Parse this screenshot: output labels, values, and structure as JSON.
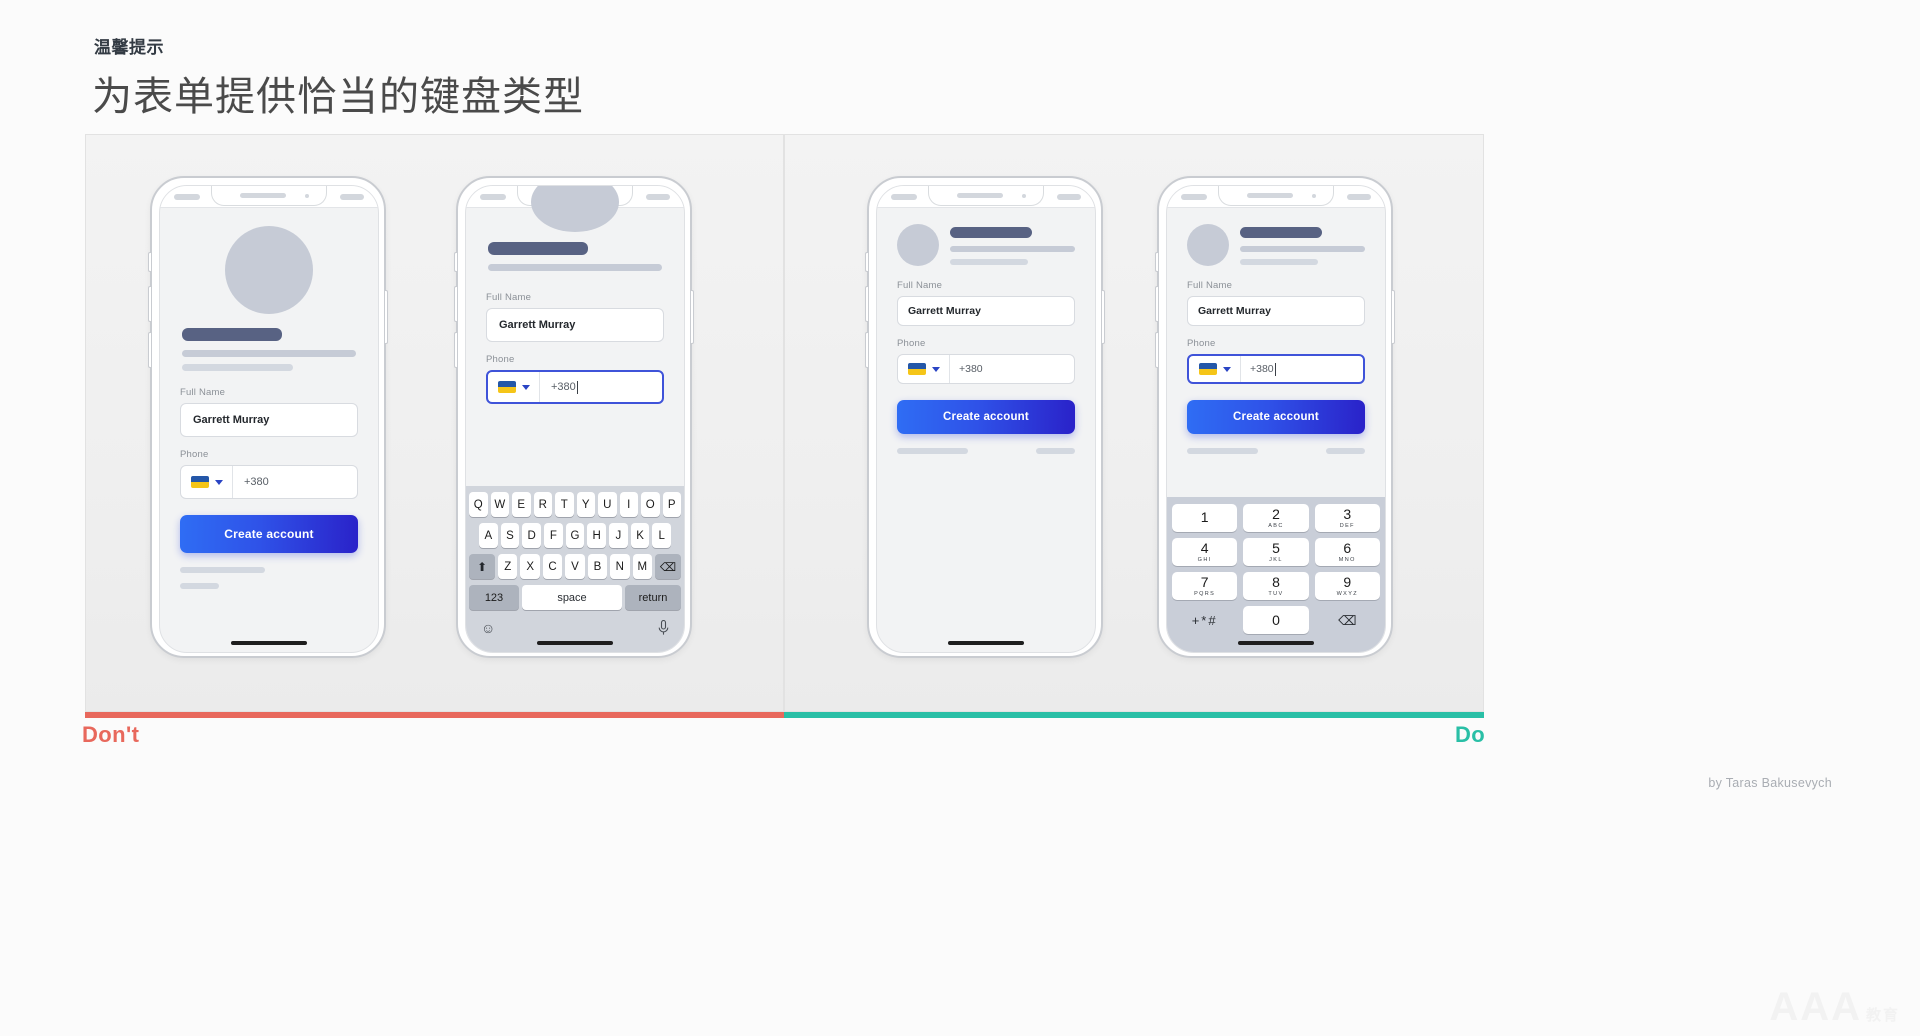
{
  "header": {
    "kicker": "温馨提示",
    "headline": "为表单提供恰当的键盘类型"
  },
  "verdicts": {
    "dont": "Don't",
    "do": "Do",
    "dont_color": "#e8685c",
    "do_color": "#29bfa6"
  },
  "credit": "by Taras Bakusevych",
  "watermark": {
    "text": "AAA",
    "sub": "教育"
  },
  "form": {
    "full_name_label": "Full Name",
    "full_name_value": "Garrett Murray",
    "phone_label": "Phone",
    "phone_placeholder": "+380",
    "cta_label": "Create account",
    "country_flag": "ukraine-flag"
  },
  "keyboard_qwerty": {
    "row1": [
      "Q",
      "W",
      "E",
      "R",
      "T",
      "Y",
      "U",
      "I",
      "O",
      "P"
    ],
    "row2": [
      "A",
      "S",
      "D",
      "F",
      "G",
      "H",
      "J",
      "K",
      "L"
    ],
    "row3": [
      "Z",
      "X",
      "C",
      "V",
      "B",
      "N",
      "M"
    ],
    "shift": "⬆",
    "backspace": "⌫",
    "numbers_key": "123",
    "space_key": "space",
    "return_key": "return",
    "emoji": "☺",
    "mic": "🎤"
  },
  "keypad_numeric": {
    "keys": [
      {
        "digit": "1",
        "letters": ""
      },
      {
        "digit": "2",
        "letters": "ABC"
      },
      {
        "digit": "3",
        "letters": "DEF"
      },
      {
        "digit": "4",
        "letters": "GHI"
      },
      {
        "digit": "5",
        "letters": "JKL"
      },
      {
        "digit": "6",
        "letters": "MNO"
      },
      {
        "digit": "7",
        "letters": "PQRS"
      },
      {
        "digit": "8",
        "letters": "TUV"
      },
      {
        "digit": "9",
        "letters": "WXYZ"
      },
      {
        "digit": "+*#",
        "letters": ""
      },
      {
        "digit": "0",
        "letters": ""
      },
      {
        "digit": "⌫",
        "letters": ""
      }
    ]
  }
}
